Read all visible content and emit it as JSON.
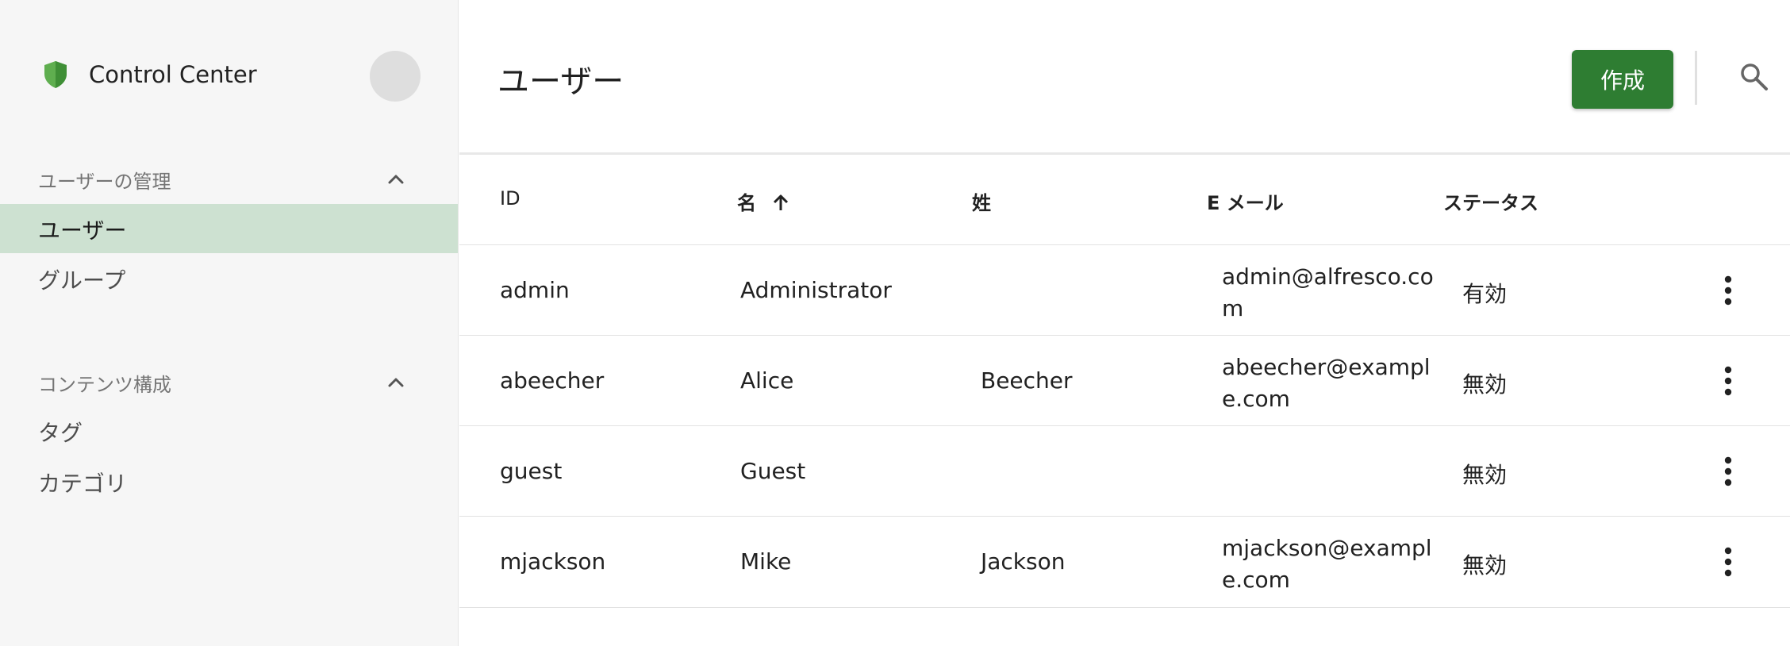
{
  "app": {
    "title": "Control Center"
  },
  "sidebar": {
    "sections": [
      {
        "title": "ユーザーの管理",
        "items": [
          "ユーザー",
          "グループ"
        ]
      },
      {
        "title": "コンテンツ構成",
        "items": [
          "タグ",
          "カテゴリ"
        ]
      }
    ],
    "active_item": "ユーザー"
  },
  "page": {
    "title": "ユーザー"
  },
  "toolbar": {
    "create_label": "作成",
    "search_icon": "search-icon"
  },
  "table": {
    "columns": [
      "ID",
      "名",
      "姓",
      "E メール",
      "ステータス"
    ],
    "sort": {
      "column": "名",
      "direction": "ascending"
    },
    "rows": [
      {
        "id": "admin",
        "first": "Administrator",
        "last": "",
        "email": "admin@alfresco.com",
        "status": "有効"
      },
      {
        "id": "abeecher",
        "first": "Alice",
        "last": "Beecher",
        "email": "abeecher@example.com",
        "status": "無効"
      },
      {
        "id": "guest",
        "first": "Guest",
        "last": "",
        "email": "",
        "status": "無効"
      },
      {
        "id": "mjackson",
        "first": "Mike",
        "last": "Jackson",
        "email": "mjackson@example.com",
        "status": "無効"
      }
    ]
  },
  "colors": {
    "accent": "#2e7d32",
    "active_nav": "#cde1d1",
    "shield": "#5fae4f"
  }
}
